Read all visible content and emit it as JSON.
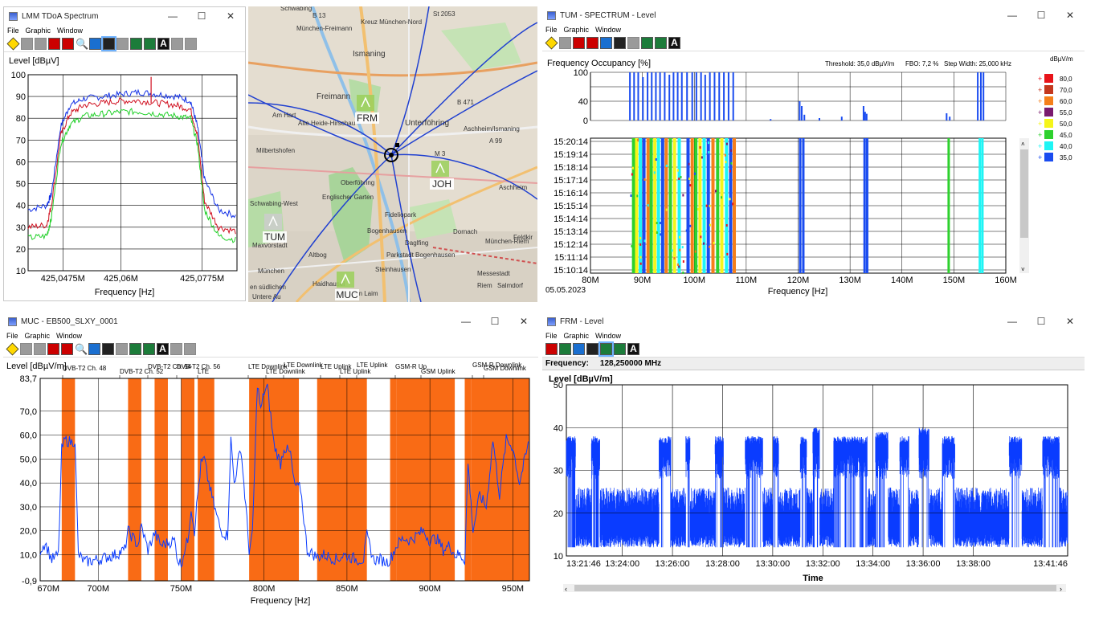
{
  "colors": {
    "blue": "#1432e6",
    "red": "#d01020",
    "green": "#22d02a",
    "orange": "#f96b15",
    "signal": "#0a3cff"
  },
  "w1": {
    "title": "LMM TDoA Spectrum",
    "menu": [
      "File",
      "Graphic",
      "Window"
    ],
    "ylabel": "Level [dBµV]",
    "xlabel": "Frequency [Hz]"
  },
  "map": {
    "places": [
      "Ismaning",
      "Unterföhring",
      "Freimann",
      "Am Hart",
      "Milbertshofen",
      "Alte Heide-Hirschau",
      "Oberföhring",
      "Fideliopark",
      "Bogenhausen",
      "Daglfing",
      "Dornach",
      "Aschheim",
      "Steinhausen",
      "München",
      "Maxvorstadt",
      "Haidhausel",
      "Riem",
      "Messestadt",
      "Salmdorf",
      "Feldkir",
      "Untere Au",
      "Am Laim",
      "Schwabing-West",
      "Englischer Garten",
      "Parkstadt Bogenhausen",
      "Altbog",
      "en südlichen",
      "Kreuz München-Nord",
      "München-Freimann",
      "St 2053",
      "B 13",
      "B 471",
      "A 99",
      "M 3",
      "Aschheim/Ismaning",
      "München-Riem",
      "Schwabing"
    ],
    "stations": [
      "FRM",
      "JOH",
      "TUM",
      "MUC"
    ]
  },
  "w2": {
    "title": "TUM - SPECTRUM - Level",
    "menu": [
      "File",
      "Graphic",
      "Window"
    ],
    "occ_label": "Frequency Occupancy [%]",
    "threshold": "Threshold: 35,0 dBµV/m",
    "fbo": "FBO: 7,2 %",
    "step": "Step Width: 25,000 kHz",
    "unit": "dBµV/m",
    "date": "05.05.2023",
    "xlabel": "Frequency [Hz]",
    "legend": [
      {
        "v": "80,0",
        "c": "#e8141a"
      },
      {
        "v": "70,0",
        "c": "#c4381e"
      },
      {
        "v": "60,0",
        "c": "#f57f1a"
      },
      {
        "v": "55,0",
        "c": "#7a1a6e"
      },
      {
        "v": "50,0",
        "c": "#f5f51a"
      },
      {
        "v": "45,0",
        "c": "#2ed12e"
      },
      {
        "v": "40,0",
        "c": "#1ef5f5"
      },
      {
        "v": "35,0",
        "c": "#1a4cf0"
      }
    ]
  },
  "w3": {
    "title": "MUC - EB500_SLXY_0001",
    "menu": [
      "File",
      "Graphic",
      "Window"
    ],
    "ylabel": "Level [dBµV/m]",
    "xlabel": "Frequency [Hz]",
    "bands": [
      {
        "label": "DVB-T2 Ch. 48",
        "a": 678,
        "b": 686
      },
      {
        "label": "DVB-T2 Ch. 52",
        "a": 718,
        "b": 726
      },
      {
        "label": "DVB-T2 Ch. 54",
        "a": 734,
        "b": 742
      },
      {
        "label": "DVB-T2 Ch. 56",
        "a": 750,
        "b": 758
      },
      {
        "label": "LTE",
        "a": 760,
        "b": 770
      },
      {
        "label": "LTE Downlink",
        "a": 791,
        "b": 821
      },
      {
        "label": "LTE Downlink",
        "a": 821,
        "b": 821
      },
      {
        "label": "LTE Downlink",
        "a": 821,
        "b": 821
      },
      {
        "label": "LTE Uplink",
        "a": 832,
        "b": 862
      },
      {
        "label": "LTE Uplink",
        "a": 862,
        "b": 862
      },
      {
        "label": "LTE Uplink",
        "a": 862,
        "b": 862
      },
      {
        "label": "GSM-R Up",
        "a": 876,
        "b": 880
      },
      {
        "label": "GSM Uplink",
        "a": 880,
        "b": 915
      },
      {
        "label": "GSM-R Downlink",
        "a": 921,
        "b": 925
      },
      {
        "label": "GSM Downlink",
        "a": 925,
        "b": 960
      }
    ]
  },
  "w4": {
    "title": "FRM - Level",
    "menu": [
      "File",
      "Graphic",
      "Window"
    ],
    "freq_label": "Frequency:",
    "freq_value": "128,250000 MHz",
    "ylabel": "Level [dBµV/m]",
    "xlabel": "Time"
  },
  "chart_data": [
    {
      "type": "line",
      "title": "",
      "ylabel": "Level [dBµV]",
      "xlabel": "Frequency [Hz]",
      "ylim": [
        10,
        100
      ],
      "xlim": [
        425.04,
        425.085
      ],
      "yticks": [
        "100",
        "90",
        "80",
        "70",
        "60",
        "50",
        "40",
        "30",
        "20",
        "10"
      ],
      "xticks": [
        {
          "x": 425.0475,
          "label": "425,0475M"
        },
        {
          "x": 425.06,
          "label": "425,06M"
        },
        {
          "x": 425.0775,
          "label": "425,0775M"
        }
      ],
      "series": [
        {
          "color": "#1432e6",
          "x": [
            425.04,
            425.044,
            425.045,
            425.047,
            425.049,
            425.052,
            425.056,
            425.06,
            425.064,
            425.068,
            425.072,
            425.075,
            425.0765,
            425.078,
            425.081,
            425.085
          ],
          "values": [
            38,
            40,
            45,
            76,
            86,
            89,
            90,
            91,
            92,
            91,
            90,
            88,
            76,
            52,
            38,
            35
          ]
        },
        {
          "color": "#d01020",
          "x": [
            425.04,
            425.044,
            425.045,
            425.047,
            425.049,
            425.052,
            425.056,
            425.06,
            425.064,
            425.068,
            425.072,
            425.075,
            425.0765,
            425.078,
            425.081,
            425.085
          ],
          "values": [
            30,
            31,
            40,
            72,
            82,
            86,
            87,
            88,
            88,
            87,
            86,
            84,
            72,
            42,
            30,
            28
          ]
        },
        {
          "color": "#22d02a",
          "x": [
            425.04,
            425.044,
            425.045,
            425.047,
            425.049,
            425.052,
            425.056,
            425.06,
            425.064,
            425.068,
            425.072,
            425.075,
            425.0765,
            425.078,
            425.081,
            425.085
          ],
          "values": [
            25,
            26,
            34,
            68,
            77,
            81,
            82,
            83,
            83,
            82,
            81,
            80,
            68,
            38,
            26,
            24
          ]
        }
      ]
    },
    {
      "type": "bar",
      "title": "Frequency Occupancy [%]",
      "xlabel": "Frequency [Hz]",
      "ylim": [
        0,
        100
      ],
      "xlim": [
        80,
        160
      ],
      "yticks": [
        "100",
        "40",
        "0"
      ],
      "time_ticks": [
        "15:20:14",
        "15:19:14",
        "15:18:14",
        "15:17:14",
        "15:16:14",
        "15:15:14",
        "15:14:14",
        "15:13:14",
        "15:12:14",
        "15:11:14",
        "15:10:14"
      ],
      "xticks": [
        {
          "x": 80,
          "label": "80M"
        },
        {
          "x": 90,
          "label": "90M"
        },
        {
          "x": 100,
          "label": "100M"
        },
        {
          "x": 110,
          "label": "110M"
        },
        {
          "x": 120,
          "label": "120M"
        },
        {
          "x": 130,
          "label": "130M"
        },
        {
          "x": 140,
          "label": "140M"
        },
        {
          "x": 150,
          "label": "150M"
        },
        {
          "x": 160,
          "label": "160M"
        }
      ],
      "x": [
        87.6,
        88.4,
        89.2,
        90.1,
        91.0,
        91.8,
        92.6,
        93.4,
        94.3,
        95.2,
        96.0,
        96.8,
        97.6,
        98.6,
        99.6,
        100.4,
        101.3,
        102.1,
        103.0,
        103.9,
        104.8,
        105.7,
        106.6,
        107.5,
        114.7,
        120.3,
        120.7,
        121.2,
        124.1,
        128.4,
        132.6,
        132.9,
        133.2,
        148.6,
        149.2,
        154.6,
        155.2,
        155.7
      ],
      "values": [
        100,
        100,
        100,
        90,
        100,
        100,
        100,
        100,
        100,
        95,
        100,
        100,
        100,
        100,
        100,
        100,
        100,
        95,
        100,
        100,
        100,
        100,
        100,
        100,
        3,
        40,
        30,
        12,
        5,
        8,
        30,
        18,
        14,
        15,
        8,
        100,
        100,
        100
      ],
      "waterfall_lines": [
        88.3,
        88.9,
        89.6,
        90.3,
        91.1,
        91.7,
        92.4,
        93.1,
        93.9,
        94.6,
        95.4,
        96.2,
        97.1,
        98.8,
        99.6,
        100.3,
        101.1,
        101.9,
        102.7,
        103.6,
        104.5,
        105.3,
        106.2,
        107.0,
        107.7,
        120.4,
        121.0,
        132.8,
        133.3,
        149.0,
        155.0,
        155.5
      ]
    },
    {
      "type": "line",
      "title": "",
      "ylabel": "Level [dBµV/m]",
      "xlabel": "Frequency [Hz]",
      "ylim": [
        -0.9,
        83.7
      ],
      "xlim": [
        665,
        960
      ],
      "yticks": [
        {
          "v": 83.7,
          "label": "83,7"
        },
        {
          "v": 70,
          "label": "70,0"
        },
        {
          "v": 60,
          "label": "60,0"
        },
        {
          "v": 50,
          "label": "50,0"
        },
        {
          "v": 40,
          "label": "40,0"
        },
        {
          "v": 30,
          "label": "30,0"
        },
        {
          "v": 20,
          "label": "20,0"
        },
        {
          "v": 10,
          "label": "10,0"
        },
        {
          "v": -0.9,
          "label": "-0,9"
        }
      ],
      "xticks": [
        {
          "x": 670,
          "label": "670M"
        },
        {
          "x": 700,
          "label": "700M"
        },
        {
          "x": 750,
          "label": "750M"
        },
        {
          "x": 800,
          "label": "800M"
        },
        {
          "x": 850,
          "label": "850M"
        },
        {
          "x": 900,
          "label": "900M"
        },
        {
          "x": 950,
          "label": "950M"
        }
      ],
      "x": [
        665,
        668,
        672,
        676,
        678,
        680,
        684,
        686,
        688,
        692,
        700,
        710,
        716,
        718,
        720,
        724,
        726,
        730,
        734,
        738,
        742,
        746,
        748,
        750,
        752,
        754,
        756,
        758,
        760,
        762,
        764,
        766,
        770,
        774,
        778,
        780,
        782,
        786,
        789,
        791,
        793,
        796,
        798,
        800,
        802,
        806,
        810,
        812,
        816,
        818,
        820,
        822,
        826,
        830,
        832,
        836,
        840,
        844,
        848,
        852,
        856,
        860,
        862,
        866,
        870,
        874,
        876,
        880,
        884,
        888,
        892,
        896,
        900,
        904,
        908,
        912,
        915,
        918,
        921,
        923,
        926,
        930,
        934,
        938,
        942,
        946,
        950,
        954,
        958,
        960
      ],
      "values": [
        12,
        15,
        8,
        10,
        54,
        58,
        57,
        58,
        10,
        7,
        8,
        10,
        12,
        20,
        18,
        14,
        22,
        12,
        19,
        14,
        15,
        16,
        8,
        6,
        12,
        16,
        30,
        20,
        35,
        48,
        50,
        42,
        30,
        20,
        18,
        58,
        40,
        55,
        30,
        12,
        18,
        82,
        70,
        78,
        80,
        56,
        48,
        55,
        52,
        40,
        38,
        38,
        12,
        10,
        9,
        10,
        9,
        8,
        10,
        9,
        8,
        8,
        18,
        8,
        8,
        7,
        8,
        14,
        17,
        16,
        18,
        20,
        16,
        17,
        12,
        14,
        10,
        10,
        8,
        48,
        20,
        35,
        30,
        58,
        35,
        58,
        55,
        40,
        52,
        58
      ]
    },
    {
      "type": "line",
      "title": "",
      "ylabel": "Level [dBµV/m]",
      "xlabel": "Time",
      "ylim": [
        10,
        50
      ],
      "xlim": [
        0,
        1200
      ],
      "yticks": [
        "50",
        "40",
        "30",
        "20",
        "10"
      ],
      "xticks": [
        {
          "x": 0,
          "label": "13:21:46"
        },
        {
          "x": 134,
          "label": "13:24:00"
        },
        {
          "x": 254,
          "label": "13:26:00"
        },
        {
          "x": 374,
          "label": "13:28:00"
        },
        {
          "x": 494,
          "label": "13:30:00"
        },
        {
          "x": 614,
          "label": "13:32:00"
        },
        {
          "x": 734,
          "label": "13:34:00"
        },
        {
          "x": 854,
          "label": "13:36:00"
        },
        {
          "x": 974,
          "label": "13:38:00"
        },
        {
          "x": 1200,
          "label": "13:41:46"
        }
      ],
      "bursts": [
        [
          0,
          22,
          38
        ],
        [
          60,
          80,
          38
        ],
        [
          222,
          250,
          38
        ],
        [
          286,
          296,
          38
        ],
        [
          356,
          376,
          38
        ],
        [
          428,
          470,
          38
        ],
        [
          495,
          508,
          38
        ],
        [
          560,
          575,
          38
        ],
        [
          590,
          606,
          40
        ],
        [
          640,
          720,
          38
        ],
        [
          740,
          770,
          39
        ],
        [
          798,
          820,
          38
        ],
        [
          844,
          868,
          40
        ],
        [
          900,
          930,
          38
        ],
        [
          1060,
          1090,
          38
        ],
        [
          1140,
          1180,
          38
        ]
      ],
      "baseline": [
        12,
        26
      ]
    }
  ]
}
